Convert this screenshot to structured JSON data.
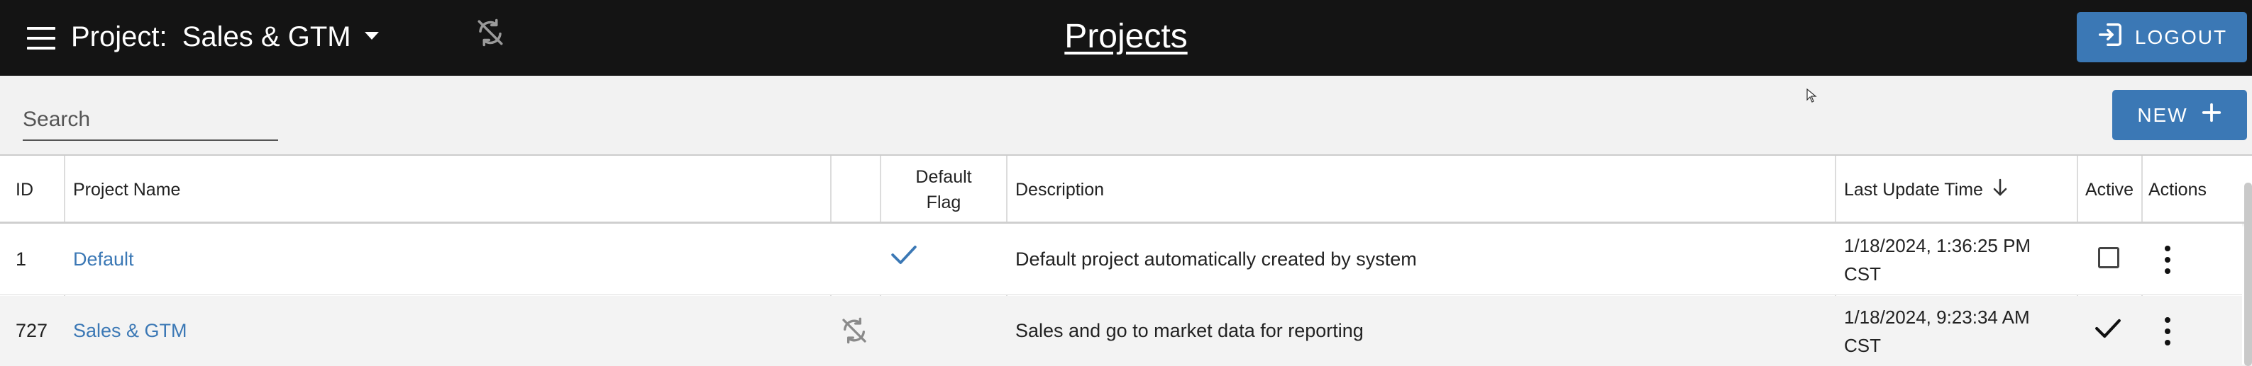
{
  "header": {
    "project_prefix": "Project:",
    "project_name": "Sales & GTM",
    "title": "Projects",
    "logout_label": "LOGOUT"
  },
  "toolbar": {
    "search_placeholder": "Search",
    "new_label": "NEW"
  },
  "table": {
    "columns": {
      "id": "ID",
      "name": "Project Name",
      "default_flag_line1": "Default",
      "default_flag_line2": "Flag",
      "description": "Description",
      "last_update": "Last Update Time",
      "active": "Active",
      "actions": "Actions"
    },
    "sort": {
      "column": "Last Update Time",
      "direction": "descending"
    },
    "rows": [
      {
        "id": "1",
        "name": "Default",
        "sync_icon": false,
        "default_flag": true,
        "description": "Default project automatically created by system",
        "last_update_line1": "1/18/2024, 1:36:25 PM",
        "last_update_line2": "CST",
        "active": false
      },
      {
        "id": "727",
        "name": "Sales & GTM",
        "sync_icon": true,
        "default_flag": false,
        "description": "Sales and go to market data for reporting",
        "last_update_line1": "1/18/2024, 9:23:34 AM",
        "last_update_line2": "CST",
        "active": true
      }
    ]
  },
  "icons": {
    "menu": "hamburger-menu-icon",
    "sync_disabled": "sync-disabled-icon",
    "logout": "logout-icon",
    "add": "plus-icon",
    "sort": "arrow-down-icon",
    "check": "checkmark-icon",
    "more": "more-vertical-icon"
  },
  "colors": {
    "topbar_bg": "#141414",
    "accent": "#3b78b5",
    "page_bg": "#f2f2f2"
  }
}
